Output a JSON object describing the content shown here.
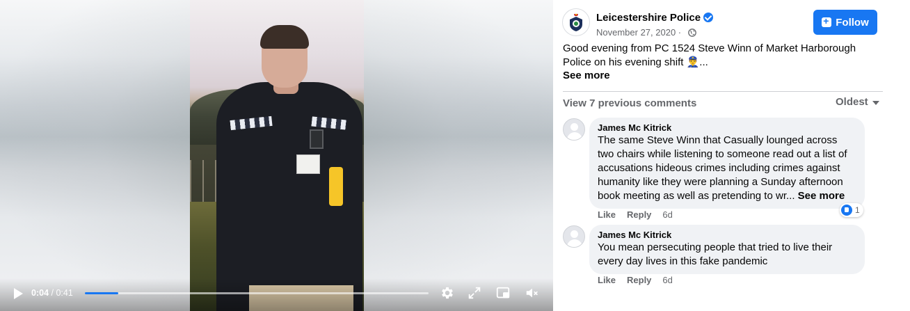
{
  "video": {
    "current_time": "0:04",
    "separator": "/",
    "duration": "0:41",
    "progress_fraction": 0.0976,
    "controls": [
      "play-icon",
      "settings-icon",
      "fullscreen-icon",
      "picture-in-picture-icon",
      "muted-volume-icon"
    ]
  },
  "post": {
    "page_name": "Leicestershire Police",
    "verified": true,
    "date": "November 27, 2020 ·",
    "privacy_icon": "globe-icon",
    "follow_label": "Follow",
    "text_line1": "Good evening from PC 1524 Steve Winn of Market Harborough",
    "text_line2": "Police on his evening shift 👮‍♂️...",
    "see_more": "See more"
  },
  "comments_header": {
    "view_previous": "View 7 previous comments",
    "sort": "Oldest"
  },
  "comments": [
    {
      "author": "James Mc Kitrick",
      "lines": [
        "The same Steve Winn that Casually lounged across",
        "two chairs while listening to someone read out a list of",
        "accusations hideous crimes including crimes against",
        "humanity like they were planning a Sunday afternoon",
        "book meeting as well as pretending to wr..."
      ],
      "see_more": "See more",
      "like": "Like",
      "reply": "Reply",
      "age": "6d",
      "reaction_count": "1"
    },
    {
      "author": "James Mc Kitrick",
      "lines": [
        "You mean persecuting people that tried to live their",
        "every day lives in this fake pandemic"
      ],
      "like": "Like",
      "reply": "Reply",
      "age": "6d"
    }
  ],
  "colors": {
    "accent": "#1877f2",
    "secondary_text": "#65676b",
    "bubble": "#f0f2f5"
  }
}
